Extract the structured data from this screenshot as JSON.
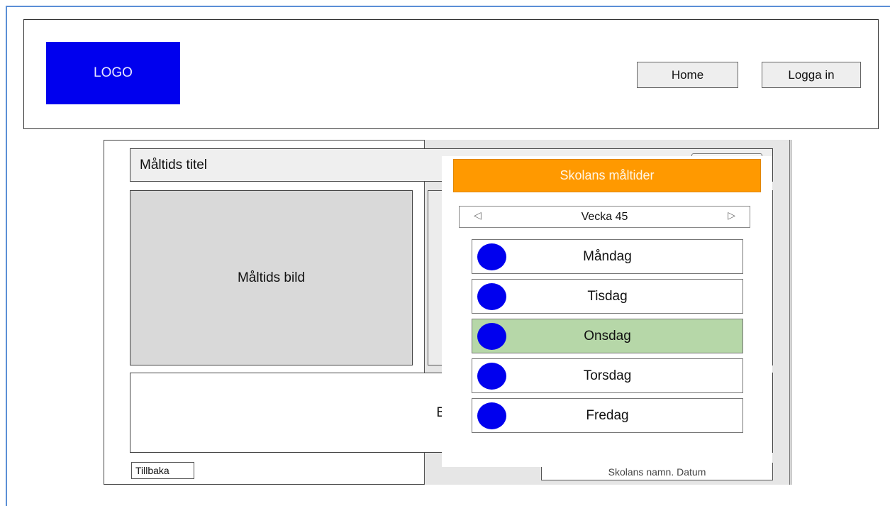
{
  "header": {
    "logo": "LOGO",
    "nav": {
      "home": "Home",
      "login": "Logga in"
    }
  },
  "meal": {
    "title": "Måltids titel",
    "image_label": "Måltids bild",
    "description": "Besk",
    "back": "Tillbaka",
    "footer": "Skolans namn. Datum"
  },
  "school_meals": {
    "title": "Skolans måltider",
    "week": "Vecka 45",
    "days": [
      {
        "label": "Måndag",
        "selected": false
      },
      {
        "label": "Tisdag",
        "selected": false
      },
      {
        "label": "Onsdag",
        "selected": true
      },
      {
        "label": "Torsdag",
        "selected": false
      },
      {
        "label": "Fredag",
        "selected": false
      }
    ]
  },
  "colors": {
    "logo": "#0000ee",
    "meals_header": "#ff9900",
    "selected_day": "#b6d7a8",
    "day_dot": "#0000ee"
  },
  "icons": {
    "prev": "triangle-left-icon",
    "next": "triangle-right-icon"
  }
}
